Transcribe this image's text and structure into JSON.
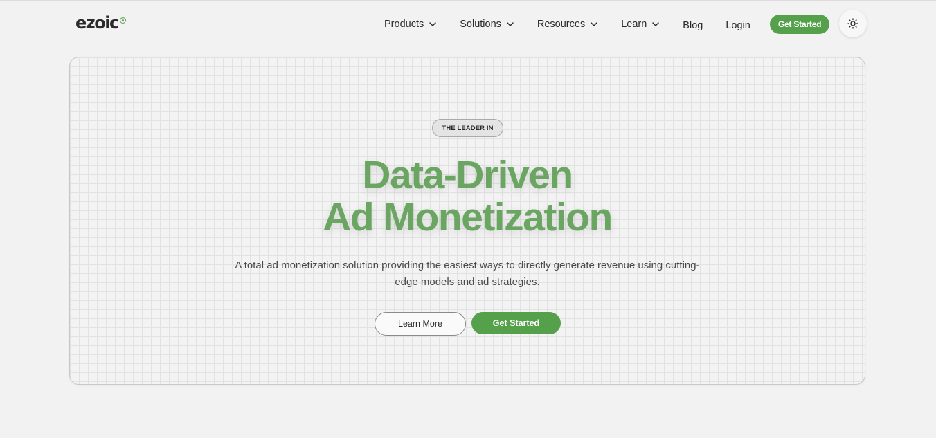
{
  "brand": {
    "logo_text": "ezoic",
    "accent_color": "#55a04a"
  },
  "nav": {
    "items": [
      {
        "label": "Products",
        "has_dropdown": true
      },
      {
        "label": "Solutions",
        "has_dropdown": true
      },
      {
        "label": "Resources",
        "has_dropdown": true
      },
      {
        "label": "Learn",
        "has_dropdown": true
      }
    ],
    "blog_label": "Blog",
    "login_label": "Login",
    "cta_label": "Get Started",
    "theme_toggle_icon": "sun-icon"
  },
  "hero": {
    "badge": "THE LEADER IN",
    "headline_line1": "Data-Driven",
    "headline_line2": "Ad Monetization",
    "headline_color": "#6aa662",
    "description": "A total ad monetization solution providing the easiest ways to directly generate revenue using cutting-edge models and ad strategies.",
    "secondary_cta": "Learn More",
    "primary_cta": "Get Started"
  }
}
